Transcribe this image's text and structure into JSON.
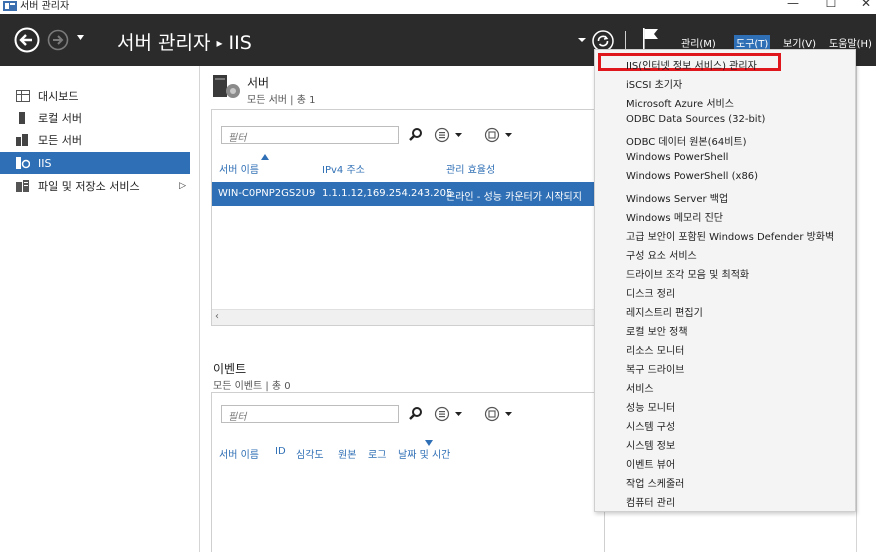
{
  "window": {
    "title": "서버 관리자",
    "controls": {
      "minimize": "—",
      "maximize": "☐",
      "close": "✕"
    }
  },
  "header": {
    "breadcrumb_root": "서버 관리자",
    "breadcrumb_sep": "▸",
    "breadcrumb_current": "IIS",
    "menus": [
      {
        "label": "관리(M)"
      },
      {
        "label": "도구(T)"
      },
      {
        "label": "보기(V)"
      },
      {
        "label": "도움말(H)"
      }
    ]
  },
  "sidebar": {
    "items": [
      {
        "label": "대시보드"
      },
      {
        "label": "로컬 서버"
      },
      {
        "label": "모든 서버"
      },
      {
        "label": "IIS"
      },
      {
        "label": "파일 및 저장소 서비스",
        "chevron": "▷"
      }
    ]
  },
  "servers": {
    "title": "서버",
    "subtitle": "모든 서버 | 총 1",
    "filter_placeholder": "필터",
    "columns": [
      "서버 이름",
      "IPv4 주소",
      "관리 효율성"
    ],
    "rows": [
      [
        "WIN-C0PNP2GS2U9",
        "1.1.1.12,169.254.243.205",
        "온라인 - 성능 카운터가 시작되지"
      ]
    ]
  },
  "events": {
    "title": "이벤트",
    "subtitle": "모든 이벤트 | 총 0",
    "filter_placeholder": "필터",
    "columns": [
      "서버 이름",
      "ID",
      "심각도",
      "원본",
      "로그",
      "날짜 및 시간"
    ]
  },
  "tools_menu": {
    "items": [
      "IIS(인터넷 정보 서비스) 관리자",
      "iSCSI 초기자",
      "Microsoft Azure 서비스",
      "ODBC Data Sources (32-bit)",
      "ODBC 데이터 원본(64비트)",
      "Windows PowerShell",
      "Windows PowerShell (x86)",
      "Windows Server 백업",
      "Windows 메모리 진단",
      "고급 보안이 포함된 Windows Defender 방화벽",
      "구성 요소 서비스",
      "드라이브 조각 모음 및 최적화",
      "디스크 정리",
      "레지스트리 편집기",
      "로컬 보안 정책",
      "리소스 모니터",
      "복구 드라이브",
      "서비스",
      "성능 모니터",
      "시스템 구성",
      "시스템 정보",
      "이벤트 뷰어",
      "작업 스케줄러",
      "컴퓨터 관리"
    ]
  },
  "colors": {
    "header_bg": "#2b2b2b",
    "accent": "#2f6fb5",
    "highlight_border": "#e0161d"
  }
}
